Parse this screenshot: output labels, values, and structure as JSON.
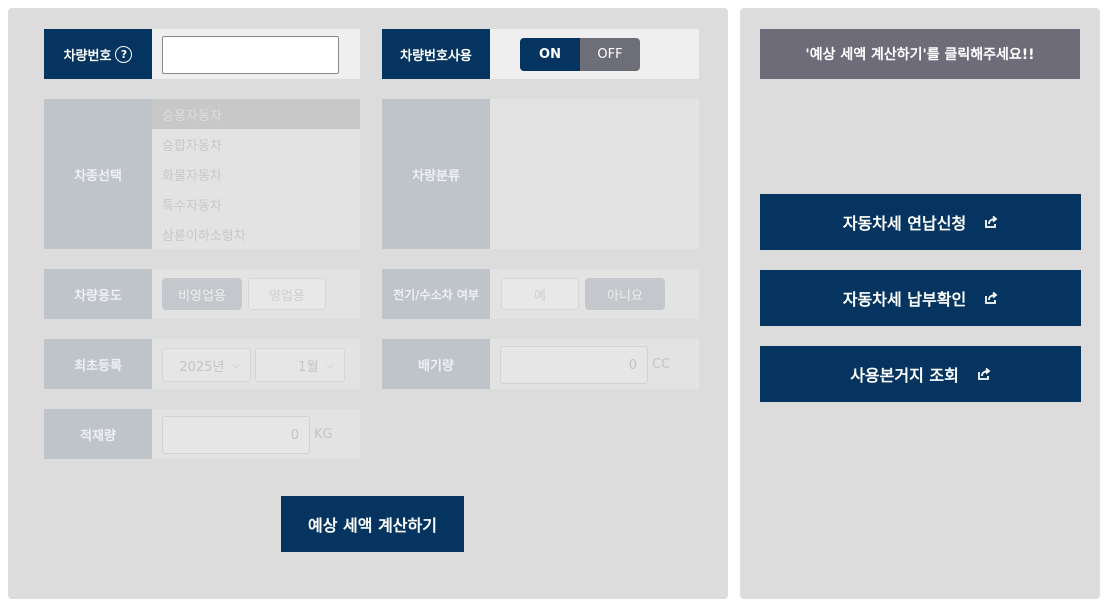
{
  "form": {
    "plate_label": "차량번호",
    "plate_help_glyph": "?",
    "plate_value": "",
    "plate_use_label": "차량번호사용",
    "toggle_on": "ON",
    "toggle_off": "OFF",
    "vehicle_type_label": "차종선택",
    "vehicle_types": [
      "승용자동차",
      "승합자동차",
      "화물자동차",
      "특수자동차",
      "삼륜이하소형차"
    ],
    "vehicle_class_label": "차량분류",
    "usage_label": "차량용도",
    "usage_opt1": "비영업용",
    "usage_opt2": "영업용",
    "electric_label": "전기/수소차 여부",
    "electric_yes": "예",
    "electric_no": "아니요",
    "first_reg_label": "최초등록",
    "year_value": "2025년",
    "month_value": "1월",
    "displacement_label": "배기량",
    "displacement_value": "0",
    "displacement_unit": "CC",
    "load_label": "적재량",
    "load_value": "0",
    "load_unit": "KG",
    "calc_button": "예상 세액 계산하기"
  },
  "side": {
    "notice": "'예상 세액 계산하기'를 클릭해주세요!!",
    "link1": "자동차세 연납신청",
    "link2": "자동차세 납부확인",
    "link3": "사용본거지 조회"
  }
}
